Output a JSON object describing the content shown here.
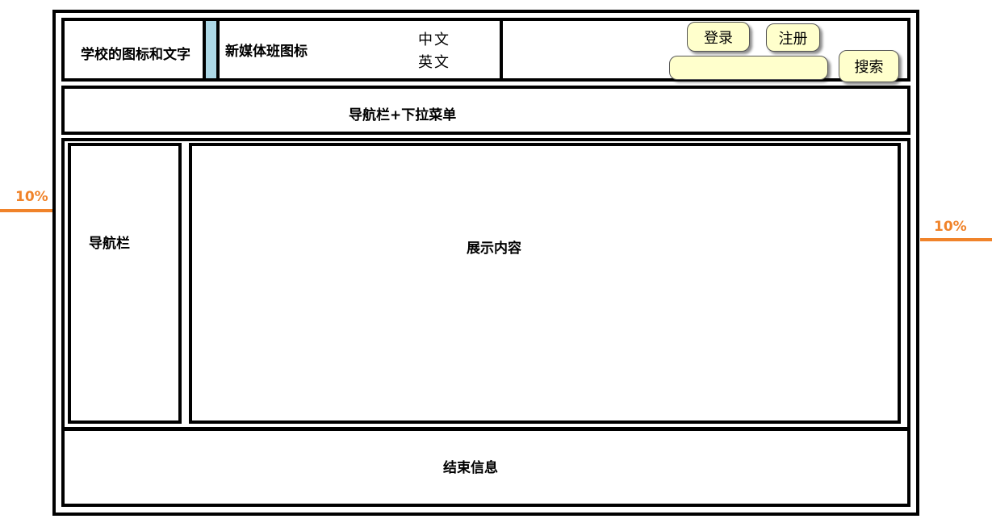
{
  "header": {
    "school_logo_text": "学校的图标和文字",
    "new_media_logo": "新媒体班图标",
    "lang_chinese": "中文",
    "lang_english": "英文",
    "login_label": "登录",
    "register_label": "注册",
    "search_label": "搜索",
    "search_value": ""
  },
  "nav_bar": {
    "label": "导航栏+下拉菜单"
  },
  "side_nav": {
    "label": "导航栏"
  },
  "content": {
    "label": "展示内容"
  },
  "footer": {
    "label": "结束信息"
  },
  "margins": {
    "left_label": "10%",
    "right_label": "10%"
  },
  "colors": {
    "accent": "#f0832a",
    "button_fill": "#ffffcc",
    "strip": "#add8e6"
  }
}
